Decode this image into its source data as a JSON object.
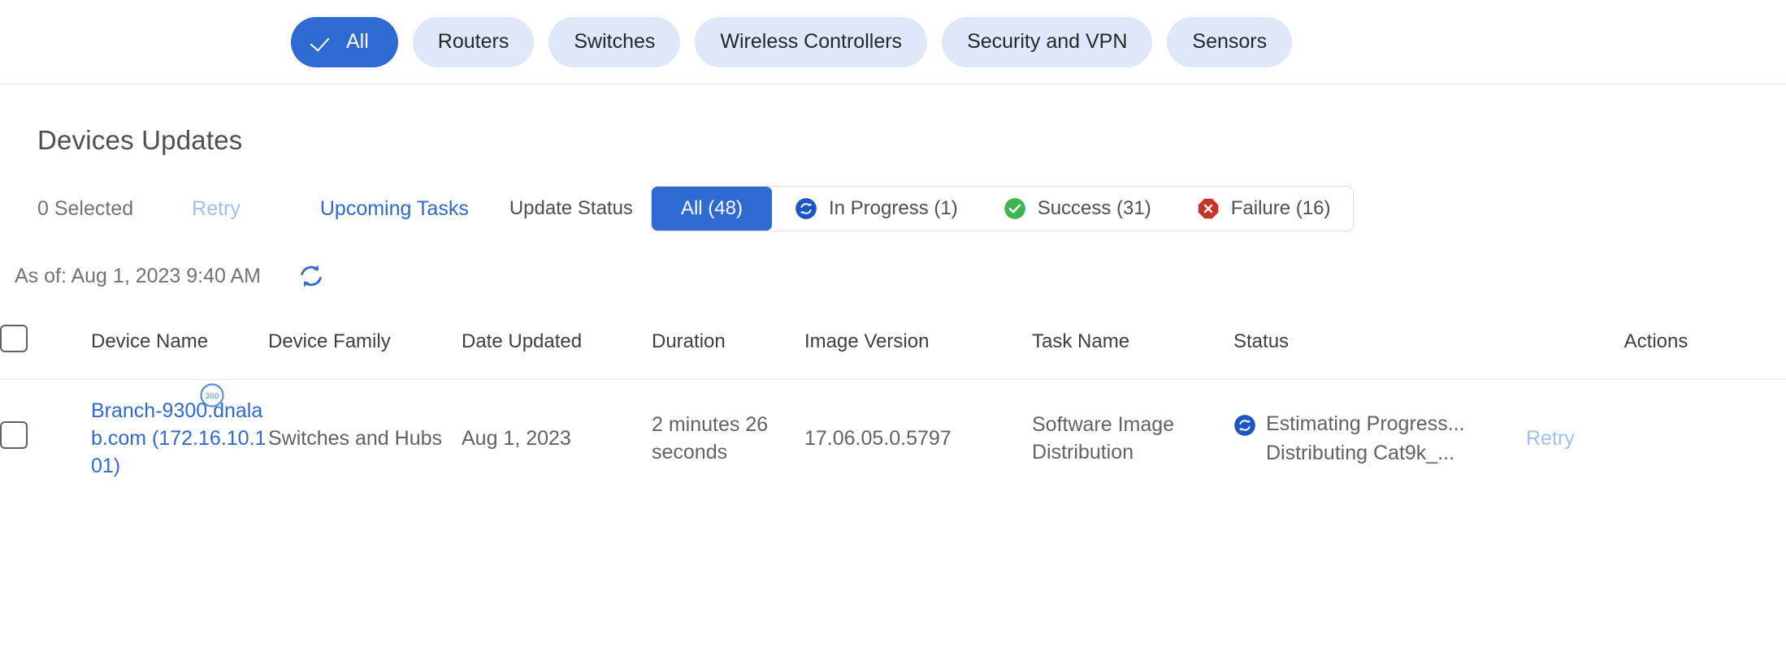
{
  "family_filter": {
    "items": [
      {
        "label": "All",
        "active": true,
        "icon": "check-icon"
      },
      {
        "label": "Routers",
        "active": false
      },
      {
        "label": "Switches",
        "active": false
      },
      {
        "label": "Wireless Controllers",
        "active": false
      },
      {
        "label": "Security and VPN",
        "active": false
      },
      {
        "label": "Sensors",
        "active": false
      }
    ]
  },
  "page": {
    "title": "Devices Updates"
  },
  "toolbar": {
    "selected_label": "0 Selected",
    "retry_label": "Retry",
    "upcoming_tasks_label": "Upcoming Tasks",
    "update_status_label": "Update Status",
    "status_segments": [
      {
        "label": "All (48)",
        "active": true,
        "icon": "none"
      },
      {
        "label": "In Progress (1)",
        "active": false,
        "icon": "in-progress-icon"
      },
      {
        "label": "Success (31)",
        "active": false,
        "icon": "success-icon"
      },
      {
        "label": "Failure (16)",
        "active": false,
        "icon": "failure-icon"
      }
    ]
  },
  "asof": {
    "text": "As of: Aug 1, 2023 9:40 AM",
    "refresh_icon": "refresh-icon"
  },
  "table": {
    "columns": [
      "Device Name",
      "Device Family",
      "Date Updated",
      "Duration",
      "Image Version",
      "Task Name",
      "Status",
      "Actions"
    ],
    "rows": [
      {
        "device_name": "Branch-9300.dnalab.com (172.16.10.101)",
        "device_badge": "360",
        "device_family": "Switches and Hubs",
        "date_updated": "Aug 1, 2023",
        "duration": "2 minutes 26 seconds",
        "image_version": "17.06.05.0.5797",
        "task_name": "Software Image Distribution",
        "status_icon": "in-progress-icon",
        "status_line1": "Estimating Progress...",
        "status_line2": "Distributing Cat9k_...",
        "action": "Retry"
      }
    ]
  },
  "colors": {
    "accent_blue": "#2e6ad1",
    "pill_blue_light": "#dfe8f9",
    "link_blue": "#2e6ad1",
    "link_blue_disabled": "#9fc0ee",
    "success_green": "#3eb553",
    "failure_red": "#c9332a",
    "text_gray": "#5f6368",
    "border_gray": "#e1e4e8"
  }
}
